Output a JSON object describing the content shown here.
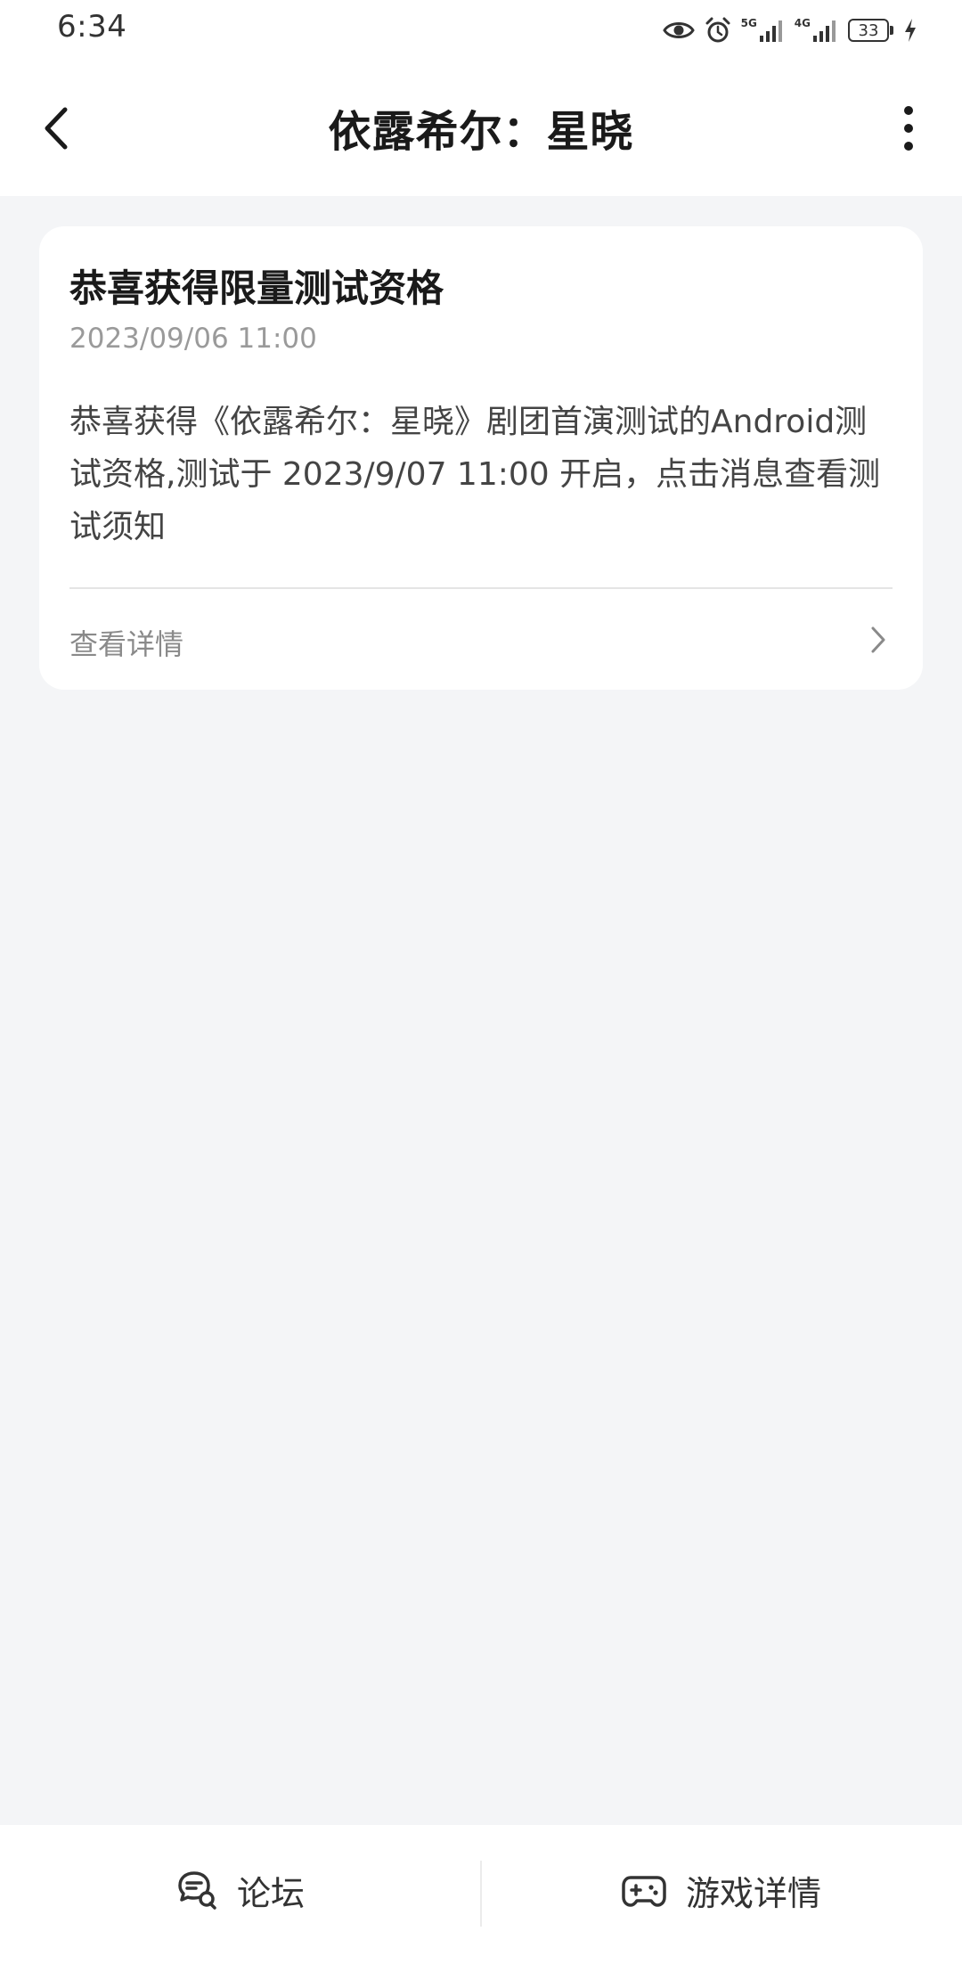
{
  "status_bar": {
    "time": "6:34",
    "network_5g": "5G",
    "network_4g": "4G",
    "battery": "33"
  },
  "header": {
    "title": "依露希尔：星晓"
  },
  "card": {
    "title": "恭喜获得限量测试资格",
    "timestamp": "2023/09/06 11:00",
    "body": "恭喜获得《依露希尔：星晓》剧团首演测试的Android测试资格,测试于 2023/9/07 11:00 开启，点击消息查看测试须知",
    "link_label": "查看详情"
  },
  "bottom_bar": {
    "forum_label": "论坛",
    "game_detail_label": "游戏详情"
  }
}
